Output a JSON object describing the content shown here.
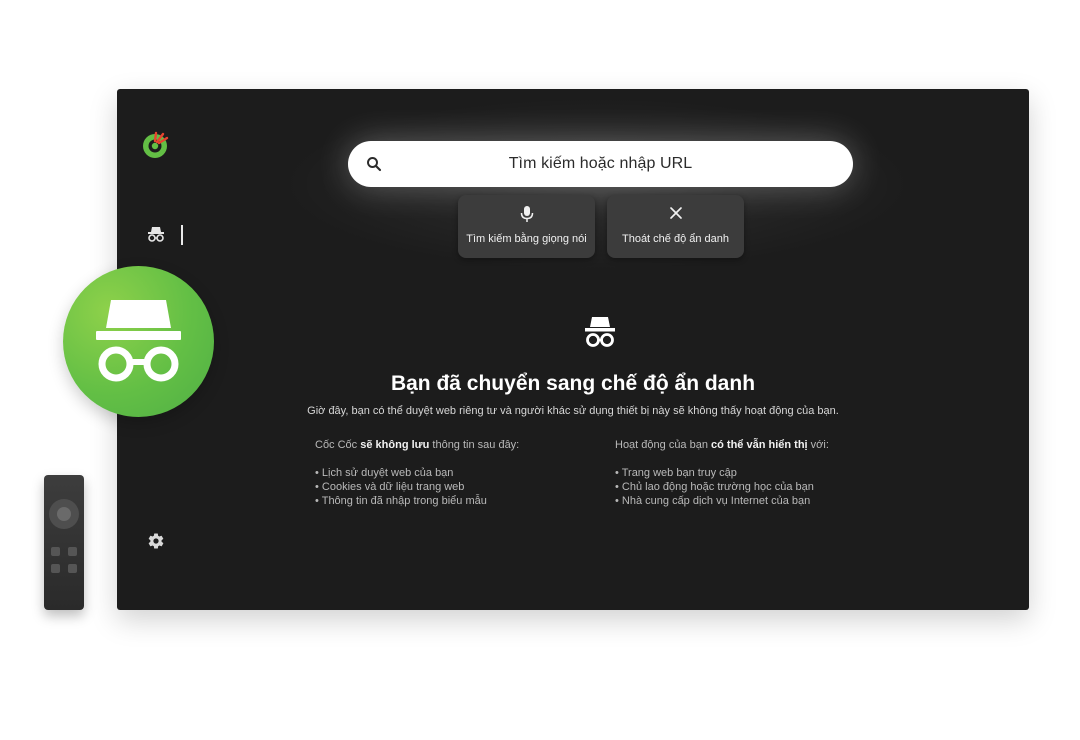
{
  "search": {
    "placeholder": "Tìm kiếm hoặc nhập URL"
  },
  "tiles": {
    "voice_label": "Tìm kiếm bằng giọng nói",
    "exit_label": "Thoát chế độ ẩn danh"
  },
  "incognito": {
    "title": "Bạn đã chuyển sang chế độ ẩn danh",
    "subtitle": "Giờ đây, bạn có thể duyệt web riêng tư và người khác sử dụng thiết bị này sẽ không thấy hoạt động của bạn.",
    "left": {
      "head_prefix": "Cốc Cốc ",
      "head_bold": "sẽ không lưu",
      "head_suffix": " thông tin sau đây:",
      "items": [
        "Lịch sử duyệt web của bạn",
        "Cookies và dữ liệu trang web",
        "Thông tin đã nhập trong biểu mẫu"
      ]
    },
    "right": {
      "head_prefix": "Hoạt động của bạn ",
      "head_bold": "có thể vẫn hiển thị",
      "head_suffix": " với:",
      "items": [
        "Trang web bạn truy cập",
        "Chủ lao động hoặc trường học của bạn",
        "Nhà cung cấp dịch vụ Internet của bạn"
      ]
    }
  },
  "icons": {
    "logo": "coccoc-logo-icon",
    "rail_incognito": "incognito-icon",
    "rail_settings": "gear-icon",
    "search": "search-icon",
    "voice": "microphone-icon",
    "exit": "close-icon",
    "hero": "incognito-icon",
    "badge": "incognito-icon"
  },
  "colors": {
    "screen_bg": "#1c1c1c",
    "tile_bg": "#3c3c3c",
    "brand_green": "#63bf45",
    "brand_red": "#e8432f"
  }
}
